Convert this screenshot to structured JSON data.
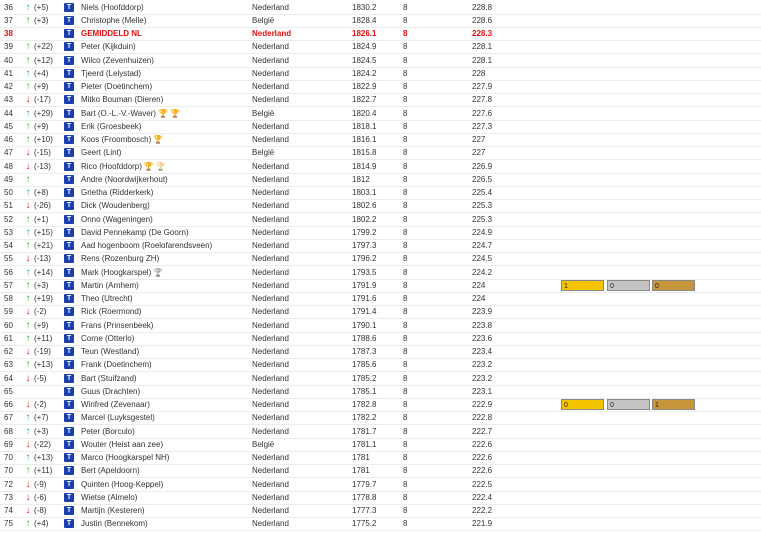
{
  "colors": {
    "up": "#2eae3a",
    "down": "#d21c1c",
    "highlight": "#e01010",
    "gold": "#f5c400",
    "silver": "#c4c4c4",
    "bronze": "#c7953a",
    "team_icon": "#1c3fae"
  },
  "icons": {
    "team_icon": "team-logo-icon",
    "trophy_gold": "gold-trophy-icon",
    "trophy_bronze": "bronze-trophy-icon",
    "trophy_grey": "grey-trophy-icon"
  },
  "rows": [
    {
      "rank": "36",
      "dir": "up",
      "change": "(+5)",
      "name": "Niels (Hoofddorp)",
      "country": "Nederland",
      "score": "1830.2",
      "games": "8",
      "avg": "228.8"
    },
    {
      "rank": "37",
      "dir": "up",
      "change": "(+3)",
      "name": "Christophe (Melle)",
      "country": "België",
      "score": "1828.4",
      "games": "8",
      "avg": "228.6"
    },
    {
      "rank": "38",
      "dir": "",
      "change": "",
      "name": "GEMIDDELD NL",
      "country": "Nederland",
      "score": "1826.1",
      "games": "8",
      "avg": "228.3",
      "highlight": true
    },
    {
      "rank": "39",
      "dir": "up",
      "change": "(+22)",
      "name": "Peter (Kijkduin)",
      "country": "Nederland",
      "score": "1824.9",
      "games": "8",
      "avg": "228.1"
    },
    {
      "rank": "40",
      "dir": "up",
      "change": "(+12)",
      "name": "Wilco (Zevenhuizen)",
      "country": "Nederland",
      "score": "1824.5",
      "games": "8",
      "avg": "228.1"
    },
    {
      "rank": "41",
      "dir": "up",
      "change": "(+4)",
      "name": "Tjeerd (Lelystad)",
      "country": "Nederland",
      "score": "1824.2",
      "games": "8",
      "avg": "228"
    },
    {
      "rank": "42",
      "dir": "up",
      "change": "(+9)",
      "name": "Pieter (Doetinchem)",
      "country": "Nederland",
      "score": "1822.9",
      "games": "8",
      "avg": "227.9"
    },
    {
      "rank": "43",
      "dir": "down",
      "change": "(-17)",
      "name": "Mitko Bouman (Dieren)",
      "country": "Nederland",
      "score": "1822.7",
      "games": "8",
      "avg": "227.8"
    },
    {
      "rank": "44",
      "dir": "up",
      "change": "(+29)",
      "name": "Bart (O.-L.-V.-Waver)",
      "country": "België",
      "score": "1820.4",
      "games": "8",
      "avg": "227.6",
      "trophies": [
        "gold",
        "gold"
      ]
    },
    {
      "rank": "45",
      "dir": "up",
      "change": "(+9)",
      "name": "Erik (Groesbeek)",
      "country": "Nederland",
      "score": "1818.1",
      "games": "8",
      "avg": "227.3"
    },
    {
      "rank": "46",
      "dir": "up",
      "change": "(+10)",
      "name": "Koos (Froombosch)",
      "country": "Nederland",
      "score": "1816.1",
      "games": "8",
      "avg": "227",
      "trophies": [
        "gold"
      ]
    },
    {
      "rank": "47",
      "dir": "down",
      "change": "(-15)",
      "name": "Geert (Lint)",
      "country": "België",
      "score": "1815.8",
      "games": "8",
      "avg": "227"
    },
    {
      "rank": "48",
      "dir": "down",
      "change": "(-13)",
      "name": "Rico (Hoofddorp)",
      "country": "Nederland",
      "score": "1814.9",
      "games": "8",
      "avg": "226.9",
      "trophies": [
        "gold",
        "bronze"
      ]
    },
    {
      "rank": "49",
      "dir": "up",
      "change": "",
      "name": "Andre (Noordwijkerhout)",
      "country": "Nederland",
      "score": "1812",
      "games": "8",
      "avg": "226.5"
    },
    {
      "rank": "50",
      "dir": "up",
      "change": "(+8)",
      "name": "Grietha (Ridderkerk)",
      "country": "Nederland",
      "score": "1803.1",
      "games": "8",
      "avg": "225.4"
    },
    {
      "rank": "51",
      "dir": "down",
      "change": "(-26)",
      "name": "Dick (Woudenberg)",
      "country": "Nederland",
      "score": "1802.6",
      "games": "8",
      "avg": "225.3"
    },
    {
      "rank": "52",
      "dir": "up",
      "change": "(+1)",
      "name": "Onno (Wageningen)",
      "country": "Nederland",
      "score": "1802.2",
      "games": "8",
      "avg": "225.3"
    },
    {
      "rank": "53",
      "dir": "up",
      "change": "(+15)",
      "name": "David Pennekamp (De Goorn)",
      "country": "Nederland",
      "score": "1799.2",
      "games": "8",
      "avg": "224.9"
    },
    {
      "rank": "54",
      "dir": "up",
      "change": "(+21)",
      "name": "Aad hogenboom (Roelofarendsveen)",
      "country": "Nederland",
      "score": "1797.3",
      "games": "8",
      "avg": "224.7"
    },
    {
      "rank": "55",
      "dir": "down",
      "change": "(-13)",
      "name": "Rens (Rozenburg ZH)",
      "country": "Nederland",
      "score": "1796.2",
      "games": "8",
      "avg": "224.5"
    },
    {
      "rank": "56",
      "dir": "up",
      "change": "(+14)",
      "name": "Mark (Hoogkarspel)",
      "country": "Nederland",
      "score": "1793.5",
      "games": "8",
      "avg": "224.2",
      "trophies": [
        "grey"
      ]
    },
    {
      "rank": "57",
      "dir": "up",
      "change": "(+3)",
      "name": "Martin (Arnhem)",
      "country": "Nederland",
      "score": "1791.9",
      "games": "8",
      "avg": "224",
      "medals": [
        "1",
        "0",
        "0"
      ]
    },
    {
      "rank": "58",
      "dir": "up",
      "change": "(+19)",
      "name": "Theo (Utrecht)",
      "country": "Nederland",
      "score": "1791.6",
      "games": "8",
      "avg": "224"
    },
    {
      "rank": "59",
      "dir": "down",
      "change": "(-2)",
      "name": "Rick (Roermond)",
      "country": "Nederland",
      "score": "1791.4",
      "games": "8",
      "avg": "223.9"
    },
    {
      "rank": "60",
      "dir": "up",
      "change": "(+9)",
      "name": "Frans (Prinsenbeek)",
      "country": "Nederland",
      "score": "1790.1",
      "games": "8",
      "avg": "223.8"
    },
    {
      "rank": "61",
      "dir": "up",
      "change": "(+11)",
      "name": "Corne (Otterlo)",
      "country": "Nederland",
      "score": "1788.6",
      "games": "8",
      "avg": "223.6"
    },
    {
      "rank": "62",
      "dir": "down",
      "change": "(-19)",
      "name": "Teun (Westland)",
      "country": "Nederland",
      "score": "1787.3",
      "games": "8",
      "avg": "223.4"
    },
    {
      "rank": "63",
      "dir": "up",
      "change": "(+13)",
      "name": "Frank (Doetinchem)",
      "country": "Nederland",
      "score": "1785.6",
      "games": "8",
      "avg": "223.2"
    },
    {
      "rank": "64",
      "dir": "down",
      "change": "(-5)",
      "name": "Bart (Stuifzand)",
      "country": "Nederland",
      "score": "1785.2",
      "games": "8",
      "avg": "223.2"
    },
    {
      "rank": "65",
      "dir": "",
      "change": "",
      "name": "Guus (Drachten)",
      "country": "Nederland",
      "score": "1785.1",
      "games": "8",
      "avg": "223.1"
    },
    {
      "rank": "66",
      "dir": "down",
      "change": "(-2)",
      "name": "Winfred (Zevenaar)",
      "country": "Nederland",
      "score": "1782.8",
      "games": "8",
      "avg": "222.9",
      "medals": [
        "0",
        "0",
        "1"
      ]
    },
    {
      "rank": "67",
      "dir": "up",
      "change": "(+7)",
      "name": "Marcel (Luyksgestel)",
      "country": "Nederland",
      "score": "1782.2",
      "games": "8",
      "avg": "222.8"
    },
    {
      "rank": "68",
      "dir": "up",
      "change": "(+3)",
      "name": "Peter (Borculo)",
      "country": "Nederland",
      "score": "1781.7",
      "games": "8",
      "avg": "222.7"
    },
    {
      "rank": "69",
      "dir": "down",
      "change": "(-22)",
      "name": "Wouter (Heist aan zee)",
      "country": "België",
      "score": "1781.1",
      "games": "8",
      "avg": "222.6"
    },
    {
      "rank": "70",
      "dir": "up",
      "change": "(+13)",
      "name": "Marco (Hoogkarspel NH)",
      "country": "Nederland",
      "score": "1781",
      "games": "8",
      "avg": "222.6"
    },
    {
      "rank": "70",
      "dir": "up",
      "change": "(+11)",
      "name": "Bert (Apeldoorn)",
      "country": "Nederland",
      "score": "1781",
      "games": "8",
      "avg": "222.6"
    },
    {
      "rank": "72",
      "dir": "down",
      "change": "(-9)",
      "name": "Quinten (Hoog-Keppel)",
      "country": "Nederland",
      "score": "1779.7",
      "games": "8",
      "avg": "222.5"
    },
    {
      "rank": "73",
      "dir": "down",
      "change": "(-6)",
      "name": "Wietse (Almelo)",
      "country": "Nederland",
      "score": "1778.8",
      "games": "8",
      "avg": "222.4"
    },
    {
      "rank": "74",
      "dir": "down",
      "change": "(-8)",
      "name": "Martijn (Kesteren)",
      "country": "Nederland",
      "score": "1777.3",
      "games": "8",
      "avg": "222.2"
    },
    {
      "rank": "75",
      "dir": "up",
      "change": "(+4)",
      "name": "Justin (Bennekom)",
      "country": "Nederland",
      "score": "1775.2",
      "games": "8",
      "avg": "221.9"
    }
  ]
}
